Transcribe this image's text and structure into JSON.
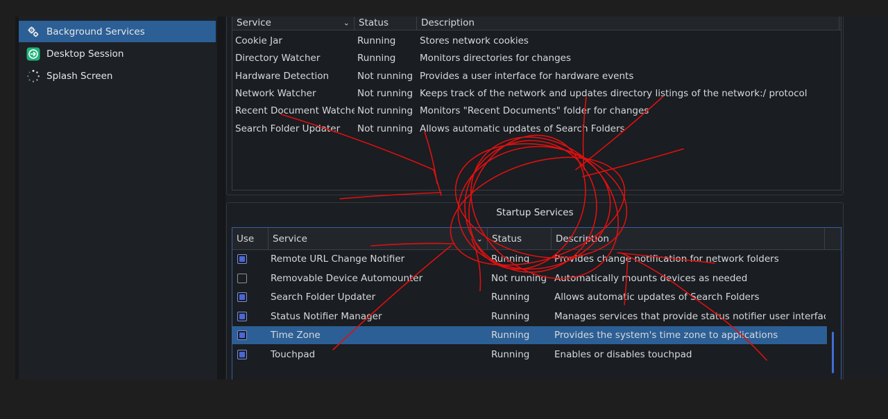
{
  "sidebar": {
    "items": [
      {
        "label": "Background Services",
        "icon": "gears-icon",
        "selected": true
      },
      {
        "label": "Desktop Session",
        "icon": "session-icon",
        "selected": false
      },
      {
        "label": "Splash Screen",
        "icon": "spinner-icon",
        "selected": false
      }
    ]
  },
  "background_table": {
    "headers": {
      "service": "Service",
      "status": "Status",
      "description": "Description"
    },
    "rows": [
      {
        "service": "Cookie Jar",
        "status": "Running",
        "description": "Stores network cookies"
      },
      {
        "service": "Directory Watcher",
        "status": "Running",
        "description": "Monitors directories for changes"
      },
      {
        "service": "Hardware Detection",
        "status": "Not running",
        "description": "Provides a user interface for hardware events"
      },
      {
        "service": "Network Watcher",
        "status": "Not running",
        "description": "Keeps track of the network and updates directory listings of the network:/ protocol"
      },
      {
        "service": "Recent Document Watcher",
        "status": "Not running",
        "description": "Monitors \"Recent Documents\" folder for changes"
      },
      {
        "service": "Search Folder Updater",
        "status": "Not running",
        "description": "Allows automatic updates of Search Folders"
      }
    ]
  },
  "startup": {
    "title": "Startup Services",
    "headers": {
      "use": "Use",
      "service": "Service",
      "status": "Status",
      "description": "Description"
    },
    "rows": [
      {
        "use": true,
        "service": "Remote URL Change Notifier",
        "status": "Running",
        "description": "Provides change notification for network folders",
        "selected": false
      },
      {
        "use": false,
        "service": "Removable Device Automounter",
        "status": "Not running",
        "description": "Automatically mounts devices as needed",
        "selected": false
      },
      {
        "use": true,
        "service": "Search Folder Updater",
        "status": "Running",
        "description": "Allows automatic updates of Search Folders",
        "selected": false
      },
      {
        "use": true,
        "service": "Status Notifier Manager",
        "status": "Running",
        "description": "Manages services that provide status notifier user interfaces",
        "selected": false
      },
      {
        "use": true,
        "service": "Time Zone",
        "status": "Running",
        "description": "Provides the system's time zone to applications",
        "selected": true
      },
      {
        "use": true,
        "service": "Touchpad",
        "status": "Running",
        "description": "Enables or disables touchpad",
        "selected": false
      }
    ]
  },
  "colors": {
    "selection": "#2c5f95",
    "checkbox_fill": "#4a67d6",
    "annotation": "#e01010"
  }
}
